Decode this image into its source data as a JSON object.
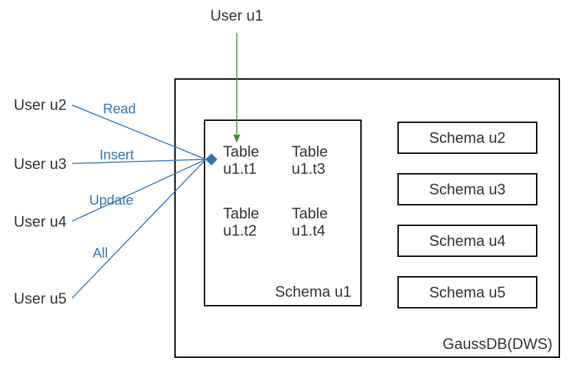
{
  "title_user": "User u1",
  "users": {
    "u2": "User u2",
    "u3": "User u3",
    "u4": "User u4",
    "u5": "User u5"
  },
  "perms": {
    "read": "Read",
    "insert": "Insert",
    "update": "Update",
    "all": "All"
  },
  "schema_u1": {
    "label": "Schema u1",
    "tables": {
      "t1_a": "Table",
      "t1_b": "u1.t1",
      "t2_a": "Table",
      "t2_b": "u1.t2",
      "t3_a": "Table",
      "t3_b": "u1.t3",
      "t4_a": "Table",
      "t4_b": "u1.t4"
    }
  },
  "schemas_right": {
    "u2": "Schema u2",
    "u3": "Schema u3",
    "u4": "Schema u4",
    "u5": "Schema u5"
  },
  "db_label": "GaussDB(DWS)"
}
